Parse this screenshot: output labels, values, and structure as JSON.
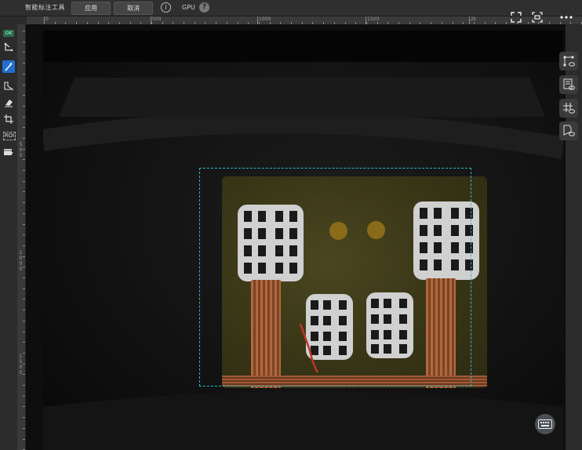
{
  "app": {
    "title": "智能标注工具",
    "apply_label": "应用",
    "cancel_label": "取消",
    "gpu_label": "GPU",
    "help_glyph": "?",
    "info_glyph": "i"
  },
  "ruler_top": {
    "labels": [
      "0",
      "500",
      "1000",
      "1500",
      "2k"
    ]
  },
  "ruler_left": {
    "labels": [
      "5\n0\n0",
      "1\n0\n0\n0",
      "1\n5\n0\n0"
    ]
  },
  "tools": {
    "ok_label": "OK",
    "roi_label": "ROI",
    "items": [
      "polygon-tool",
      "magic-wand-tool",
      "brush-tool",
      "eraser-tool",
      "crop-tool",
      "roi-tool",
      "video-tool"
    ],
    "active": "magic-wand-tool"
  },
  "colors": {
    "accent": "#1e6fd0",
    "selection": "#2fb8c8"
  }
}
